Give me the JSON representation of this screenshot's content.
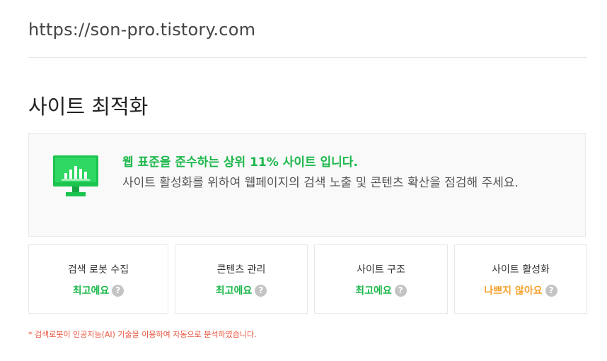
{
  "url": "https://son-pro.tistory.com",
  "section_title": "사이트 최적화",
  "summary": {
    "headline": "웹 표준을 준수하는 상위 11% 사이트 입니다.",
    "description": "사이트 활성화를 위하여 웹페이지의 검색 노출 및 콘텐츠 확산을 점검해 주세요.",
    "icon": "monitor-chart-icon",
    "accent_color": "#1cb84b"
  },
  "cards": [
    {
      "title": "검색 로봇 수집",
      "status": "최고에요",
      "status_type": "good",
      "help": "?"
    },
    {
      "title": "콘텐츠 관리",
      "status": "최고에요",
      "status_type": "good",
      "help": "?"
    },
    {
      "title": "사이트 구조",
      "status": "최고에요",
      "status_type": "good",
      "help": "?"
    },
    {
      "title": "사이트 활성화",
      "status": "나쁘지 않아요",
      "status_type": "bad",
      "help": "?"
    }
  ],
  "colors": {
    "good": "#1cb84b",
    "bad": "#f6a12b",
    "footnote": "#e8553e"
  },
  "footnote": "* 검색로봇이 인공지능(AI) 기술을 이용하여 자동으로 분석하였습니다."
}
